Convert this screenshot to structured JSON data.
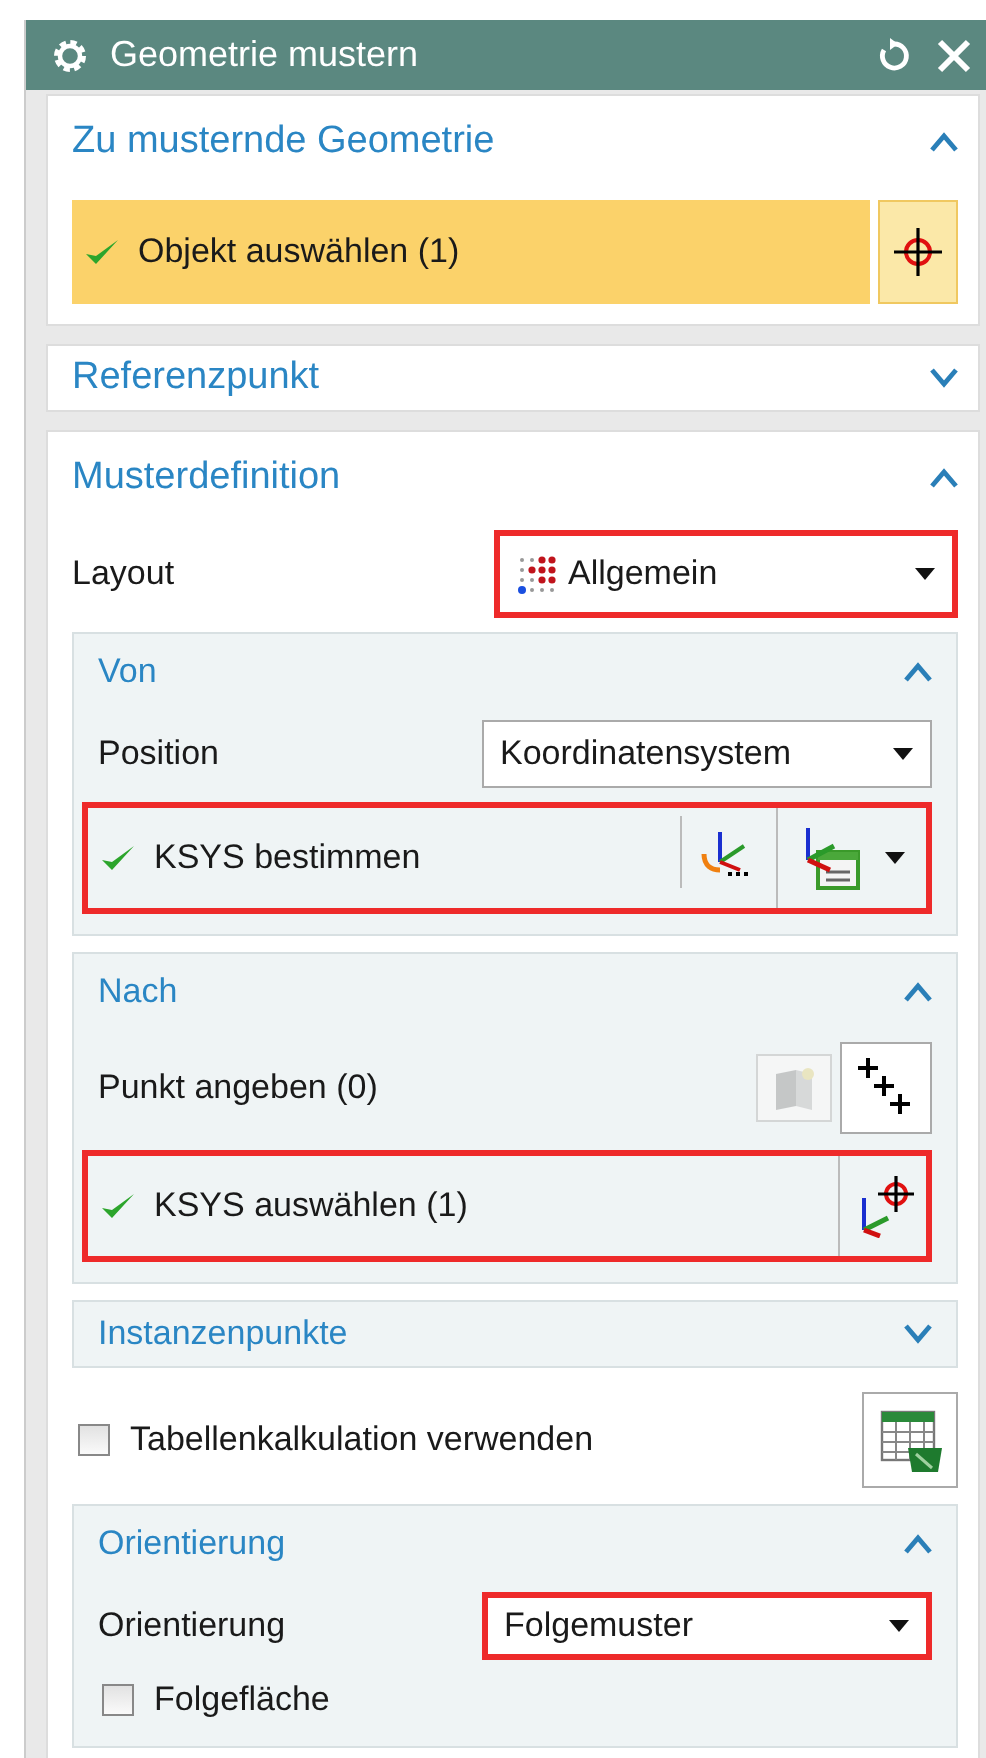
{
  "window": {
    "title": "Geometrie mustern"
  },
  "sections": [
    {
      "title": "Zu musternde Geometrie",
      "expanded": true,
      "items": [
        {
          "kind": "selection",
          "label": "Objekt auswählen (1)",
          "done": true,
          "active": true,
          "highlighted": false,
          "buttons": [
            {
              "kind": "crosshair",
              "disabled": false,
              "menu": false
            }
          ]
        }
      ]
    },
    {
      "title": "Referenzpunkt",
      "expanded": false
    },
    {
      "title": "Musterdefinition",
      "expanded": true,
      "items": [
        {
          "kind": "dropdown",
          "label": "Layout",
          "value": "Allgemein",
          "icon": true,
          "highlighted": true
        },
        {
          "kind": "group",
          "title": "Von",
          "expanded": true,
          "items": [
            {
              "kind": "dropdown",
              "label": "Position",
              "value": "Koordinatensystem",
              "icon": false,
              "highlighted": false
            },
            {
              "kind": "selection",
              "label": "KSYS bestimmen",
              "done": true,
              "active": false,
              "highlighted": true,
              "buttons": [
                {
                  "kind": "csys-dots",
                  "disabled": false,
                  "menu": false
                },
                {
                  "kind": "csys-dialog",
                  "disabled": false,
                  "menu": true
                }
              ]
            }
          ]
        },
        {
          "kind": "group",
          "title": "Nach",
          "expanded": true,
          "items": [
            {
              "kind": "label",
              "label": "Punkt angeben (0)",
              "buttons": [
                {
                  "kind": "point-dialog",
                  "disabled": true,
                  "menu": false
                },
                {
                  "kind": "points",
                  "disabled": false,
                  "menu": false
                }
              ]
            },
            {
              "kind": "selection",
              "label": "KSYS auswählen (1)",
              "done": true,
              "active": false,
              "highlighted": true,
              "buttons": [
                {
                  "kind": "csys-crosshair",
                  "disabled": false,
                  "menu": false
                }
              ]
            }
          ]
        },
        {
          "kind": "group",
          "title": "Instanzenpunkte",
          "expanded": false
        },
        {
          "kind": "checkbox",
          "label": "Tabellenkalkulation verwenden",
          "checked": false,
          "buttons": [
            {
              "kind": "spreadsheet",
              "disabled": false,
              "menu": false
            }
          ]
        },
        {
          "kind": "group",
          "title": "Orientierung",
          "expanded": true,
          "items": [
            {
              "kind": "dropdown",
              "label": "Orientierung",
              "value": "Folgemuster",
              "icon": false,
              "highlighted": true
            },
            {
              "kind": "checkbox",
              "label": "Folgefläche",
              "checked": false
            }
          ]
        }
      ]
    }
  ]
}
